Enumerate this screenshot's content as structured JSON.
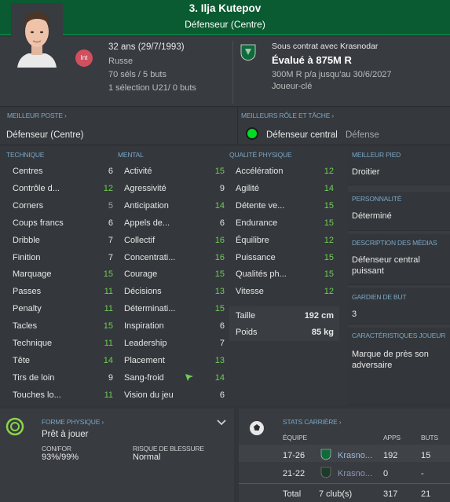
{
  "header": {
    "title": "3. Ilja Kutepov",
    "position": "Défenseur (Centre)"
  },
  "bio": {
    "age": "32 ans (29/7/1993)",
    "nationality": "Russe",
    "caps": "70 séls / 5 buts",
    "u21": "1 sélection U21/ 0 buts",
    "badge": "Int"
  },
  "contract": {
    "label": "Sous contrat avec Krasnodar",
    "value": "Évalué à 875M R",
    "wage": "300M R p/a jusqu'au 30/6/2027",
    "role": "Joueur-clé"
  },
  "best_position": {
    "label": "MEILLEUR POSTE",
    "value": "Défenseur (Centre)"
  },
  "best_role": {
    "label": "MEILLEURS RÔLE ET TÂCHE",
    "role": "Défenseur central",
    "duty": "Défense"
  },
  "technique": {
    "label": "TECHNIQUE",
    "items": [
      {
        "name": "Centres",
        "value": "6"
      },
      {
        "name": "Contrôle d...",
        "value": "12"
      },
      {
        "name": "Corners",
        "value": "5"
      },
      {
        "name": "Coups francs",
        "value": "6"
      },
      {
        "name": "Dribble",
        "value": "7"
      },
      {
        "name": "Finition",
        "value": "7"
      },
      {
        "name": "Marquage",
        "value": "15"
      },
      {
        "name": "Passes",
        "value": "11"
      },
      {
        "name": "Penalty",
        "value": "11"
      },
      {
        "name": "Tacles",
        "value": "15"
      },
      {
        "name": "Technique",
        "value": "11"
      },
      {
        "name": "Tête",
        "value": "14"
      },
      {
        "name": "Tirs de loin",
        "value": "9"
      },
      {
        "name": "Touches lo...",
        "value": "11"
      }
    ]
  },
  "mental": {
    "label": "MENTAL",
    "items": [
      {
        "name": "Activité",
        "value": "15"
      },
      {
        "name": "Agressivité",
        "value": "9"
      },
      {
        "name": "Anticipation",
        "value": "14"
      },
      {
        "name": "Appels de...",
        "value": "6"
      },
      {
        "name": "Collectif",
        "value": "16"
      },
      {
        "name": "Concentrati...",
        "value": "16"
      },
      {
        "name": "Courage",
        "value": "15"
      },
      {
        "name": "Décisions",
        "value": "13"
      },
      {
        "name": "Déterminati...",
        "value": "15"
      },
      {
        "name": "Inspiration",
        "value": "6"
      },
      {
        "name": "Leadership",
        "value": "7"
      },
      {
        "name": "Placement",
        "value": "13"
      },
      {
        "name": "Sang-froid",
        "value": "14"
      },
      {
        "name": "Vision du jeu",
        "value": "6"
      }
    ]
  },
  "physical": {
    "label": "QUALITÉ PHYSIQUE",
    "items": [
      {
        "name": "Accélération",
        "value": "12"
      },
      {
        "name": "Agilité",
        "value": "14"
      },
      {
        "name": "Détente ve...",
        "value": "15"
      },
      {
        "name": "Endurance",
        "value": "15"
      },
      {
        "name": "Équilibre",
        "value": "12"
      },
      {
        "name": "Puissance",
        "value": "15"
      },
      {
        "name": "Qualités ph...",
        "value": "15"
      },
      {
        "name": "Vitesse",
        "value": "12"
      }
    ],
    "height_label": "Taille",
    "height": "192 cm",
    "weight_label": "Poids",
    "weight": "85 kg"
  },
  "preferred_foot": {
    "label": "MEILLEUR PIED",
    "value": "Droitier"
  },
  "personality": {
    "label": "PERSONNALITÉ",
    "value": "Déterminé"
  },
  "media": {
    "label": "DESCRIPTION DES MÉDIAS",
    "value": "Défenseur central puissant"
  },
  "goalkeeper": {
    "label": "GARDIEN DE BUT",
    "value": "3"
  },
  "traits": {
    "label": "CARACTÉRISTIQUES JOUEUR",
    "value": "Marque de près son adversaire"
  },
  "condition": {
    "label": "FORME PHYSIQUE",
    "status": "Prêt à jouer",
    "confor_label": "CON/FOR",
    "confor": "93%/99%",
    "injury_label": "RISQUE DE BLESSURE",
    "injury": "Normal"
  },
  "career": {
    "label": "STATS CARRIÈRE",
    "col_team": "ÉQUIPE",
    "col_apps": "APPS",
    "col_goals": "BUTS",
    "rows": [
      {
        "season": "17-26",
        "team": "Krasno...",
        "apps": "192",
        "goals": "15"
      },
      {
        "season": "21-22",
        "team": "Krasno...",
        "apps": "0",
        "goals": "-"
      }
    ],
    "total": {
      "label": "Total",
      "team": "7 club(s)",
      "apps": "317",
      "goals": "21"
    }
  },
  "colors": {
    "header": "#0a5b31",
    "green_value": "#6ecf55",
    "label_blue": "#7aa8c8",
    "role_dot": "#00dd22"
  }
}
